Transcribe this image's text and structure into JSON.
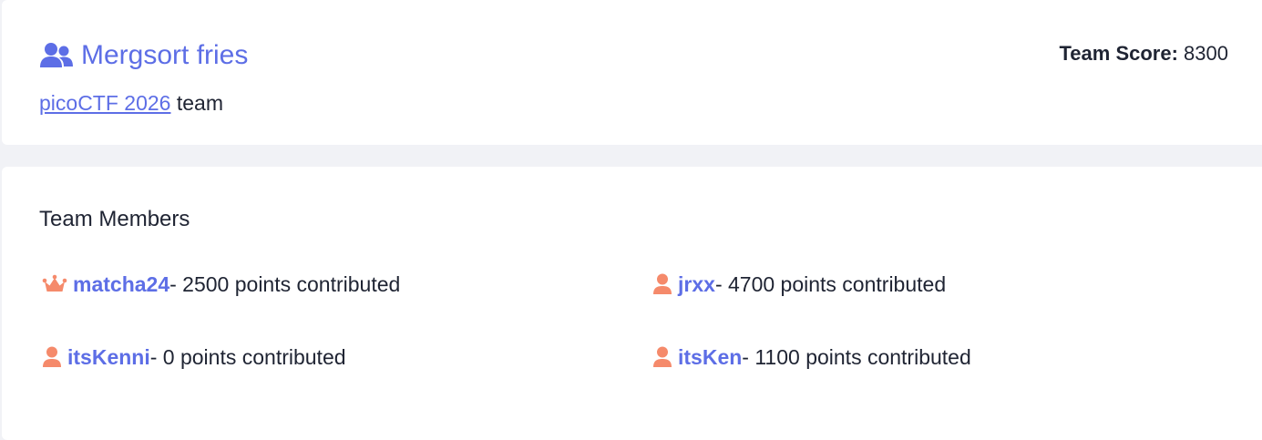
{
  "team": {
    "name": "Mergsort fries",
    "icon": "users-icon",
    "competition_link": "picoCTF 2026",
    "sub_suffix": " team",
    "score_label": "Team Score:",
    "score_value": "8300"
  },
  "members_section": {
    "title": "Team Members",
    "members": [
      {
        "name": "matcha24",
        "points_text": " - 2500 points contributed",
        "icon": "crown-icon",
        "captain": true
      },
      {
        "name": "jrxx",
        "points_text": " - 4700 points contributed",
        "icon": "user-icon",
        "captain": false
      },
      {
        "name": "itsKenni",
        "points_text": " - 0 points contributed",
        "icon": "user-icon",
        "captain": false
      },
      {
        "name": "itsKen",
        "points_text": " - 1100 points contributed",
        "icon": "user-icon",
        "captain": false
      }
    ]
  },
  "colors": {
    "accent": "#5d6ee6",
    "member_icon": "#f58a6b",
    "background": "#f1f2f6",
    "card": "#ffffff",
    "text": "#1f2433"
  }
}
